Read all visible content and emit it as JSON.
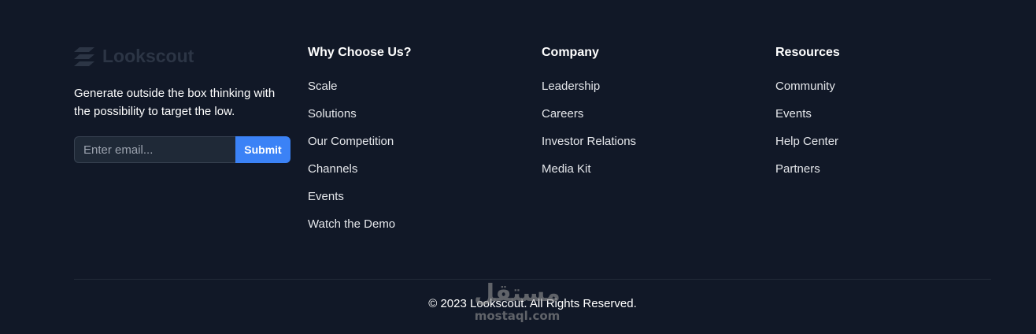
{
  "brand": {
    "name": "Lookscout",
    "logo_icon": "stacked-layers-icon",
    "tagline": "Generate outside the box thinking with the possibility to target the low."
  },
  "newsletter": {
    "placeholder": "Enter email...",
    "value": "",
    "submit_label": "Submit"
  },
  "columns": [
    {
      "heading": "Why Choose Us?",
      "links": [
        "Scale",
        "Solutions",
        "Our Competition",
        "Channels",
        "Events",
        "Watch the Demo"
      ]
    },
    {
      "heading": "Company",
      "links": [
        "Leadership",
        "Careers",
        "Investor Relations",
        "Media Kit"
      ]
    },
    {
      "heading": "Resources",
      "links": [
        "Community",
        "Events",
        "Help Center",
        "Partners"
      ]
    }
  ],
  "copyright": "© 2023 Lookscout. All Rights Reserved.",
  "watermark": {
    "arabic": "مستقل",
    "latin": "mostaql.com"
  },
  "colors": {
    "background": "#111827",
    "accent": "#3b82f6",
    "input_background": "#1f2937",
    "input_border": "#374151",
    "logo": "#2c3545",
    "text": "#ffffff",
    "link": "#e5e7eb",
    "placeholder": "#9ca3af"
  }
}
